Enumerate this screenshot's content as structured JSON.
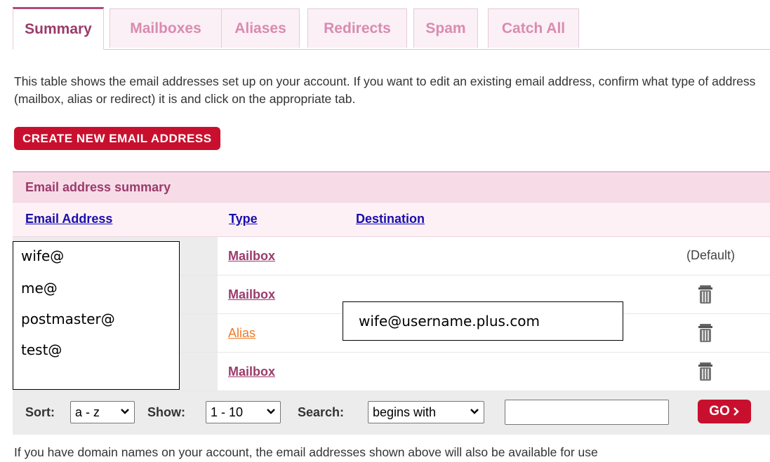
{
  "tabs": [
    {
      "label": "Summary",
      "active": true
    },
    {
      "label": "Mailboxes"
    },
    {
      "label": "Aliases"
    },
    {
      "label": "Redirects"
    },
    {
      "label": "Spam"
    },
    {
      "label": "Catch All"
    }
  ],
  "intro_text": "This table shows the email addresses set up on your account. If you want to edit an existing email address, confirm what type of address (mailbox, alias or redirect) it is and click on the appropriate tab.",
  "create_button_label": "CREATE NEW EMAIL ADDRESS",
  "table": {
    "title": "Email address summary",
    "headers": {
      "email": "Email Address",
      "type": "Type",
      "destination": "Destination"
    },
    "rows": [
      {
        "type": "Mailbox",
        "extra": "(Default)"
      },
      {
        "type": "Mailbox",
        "extra": ""
      },
      {
        "type": "Alias",
        "extra": ""
      },
      {
        "type": "Mailbox",
        "extra": ""
      }
    ]
  },
  "overlay_emails": [
    "wife@",
    "me@",
    "postmaster@",
    "test@"
  ],
  "overlay_destination": "wife@username.plus.com",
  "filter": {
    "sort_label": "Sort:",
    "sort_value": "a - z",
    "show_label": "Show:",
    "show_value": "1 - 10",
    "search_label": "Search:",
    "search_mode": "begins with",
    "search_value": "",
    "go_label": "GO"
  },
  "footer_text": "If you have domain names on your account, the email addresses shown above will also be available for use",
  "colors": {
    "brand_red": "#c8102e",
    "tab_accent": "#9b3b6b",
    "link_blue": "#1a0dab",
    "alias_orange": "#f07a2a"
  }
}
